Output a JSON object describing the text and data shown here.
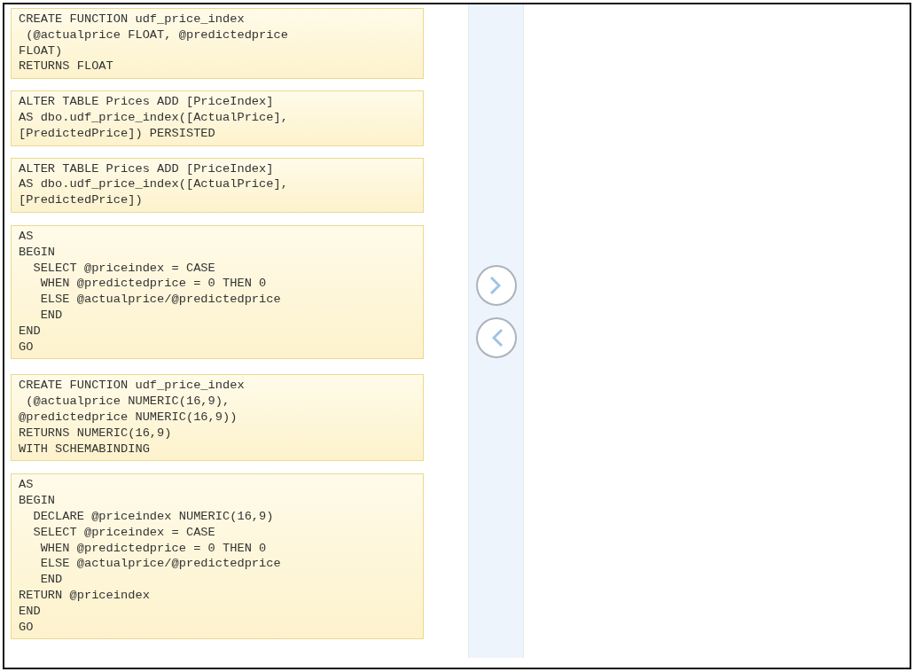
{
  "answer_choices": [
    {
      "code": "CREATE FUNCTION udf_price_index\n (@actualprice FLOAT, @predictedprice\nFLOAT)\nRETURNS FLOAT"
    },
    {
      "code": "ALTER TABLE Prices ADD [PriceIndex]\nAS dbo.udf_price_index([ActualPrice],\n[PredictedPrice]) PERSISTED"
    },
    {
      "code": "ALTER TABLE Prices ADD [PriceIndex]\nAS dbo.udf_price_index([ActualPrice],\n[PredictedPrice])"
    },
    {
      "code": "AS\nBEGIN\n  SELECT @priceindex = CASE\n   WHEN @predictedprice = 0 THEN 0\n   ELSE @actualprice/@predictedprice\n   END\nEND\nGO"
    },
    {
      "code": "CREATE FUNCTION udf_price_index\n (@actualprice NUMERIC(16,9),\n@predictedprice NUMERIC(16,9))\nRETURNS NUMERIC(16,9)\nWITH SCHEMABINDING"
    },
    {
      "code": "AS\nBEGIN\n  DECLARE @priceindex NUMERIC(16,9)\n  SELECT @priceindex = CASE\n   WHEN @predictedprice = 0 THEN 0\n   ELSE @actualprice/@predictedprice\n   END\nRETURN @priceindex\nEND\nGO"
    }
  ]
}
